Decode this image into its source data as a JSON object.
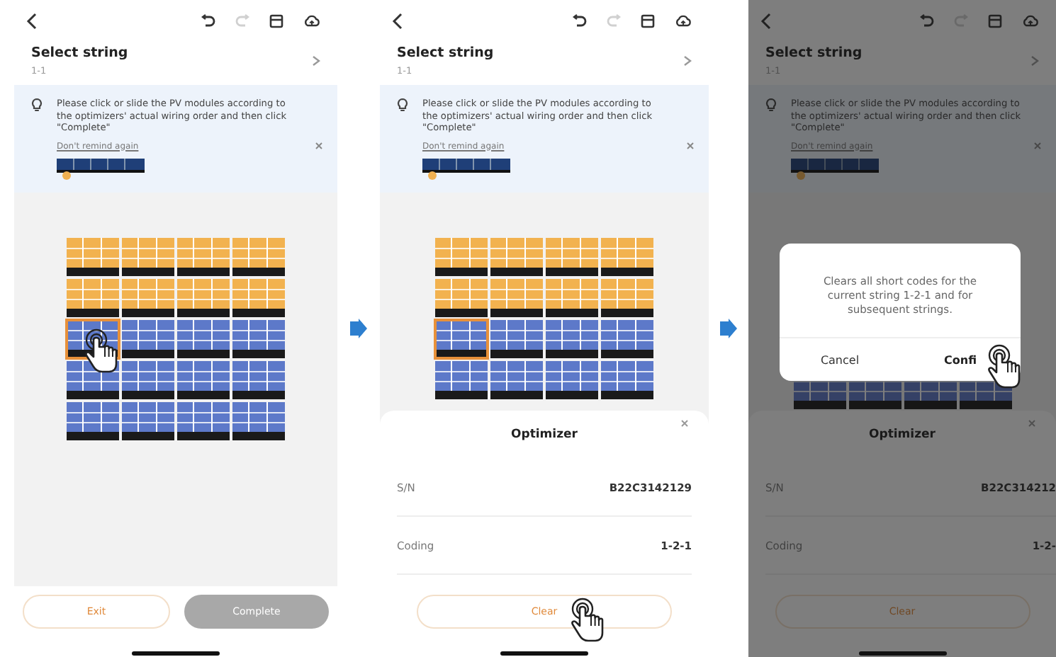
{
  "screens": [
    {
      "redo_disabled": true,
      "title": "Select string",
      "subtitle": "1-1",
      "hint": {
        "text": "Please click or slide the PV modules according to the optimizers' actual wiring order and then click \"Complete\"",
        "link": "Don't remind again"
      },
      "hand_on_selected": true,
      "grid": [
        {
          "cells": [
            {
              "coded": true,
              "selected": false
            },
            {
              "coded": true,
              "selected": false
            },
            {
              "coded": true,
              "selected": false
            },
            {
              "coded": true,
              "selected": false
            }
          ]
        },
        {
          "cells": [
            {
              "coded": true,
              "selected": false
            },
            {
              "coded": true,
              "selected": false
            },
            {
              "coded": true,
              "selected": false
            },
            {
              "coded": true,
              "selected": false
            }
          ]
        },
        {
          "cells": [
            {
              "coded": false,
              "selected": true
            },
            {
              "coded": false,
              "selected": false
            },
            {
              "coded": false,
              "selected": false
            },
            {
              "coded": false,
              "selected": false
            }
          ]
        },
        {
          "cells": [
            {
              "coded": false,
              "selected": false
            },
            {
              "coded": false,
              "selected": false
            },
            {
              "coded": false,
              "selected": false
            },
            {
              "coded": false,
              "selected": false
            }
          ]
        },
        {
          "cells": [
            {
              "coded": false,
              "selected": false
            },
            {
              "coded": false,
              "selected": false
            },
            {
              "coded": false,
              "selected": false
            },
            {
              "coded": false,
              "selected": false
            }
          ]
        }
      ],
      "buttons": [
        {
          "label": "Exit",
          "kind": "outline"
        },
        {
          "label": "Complete",
          "kind": "filled",
          "disabled": true
        }
      ]
    },
    {
      "redo_disabled": true,
      "title": "Select string",
      "subtitle": "1-1",
      "hint": {
        "text": "Please click or slide the PV modules according to the optimizers' actual wiring order and then click \"Complete\"",
        "link": "Don't remind again"
      },
      "grid": [
        {
          "cells": [
            {
              "coded": true,
              "selected": false
            },
            {
              "coded": true,
              "selected": false
            },
            {
              "coded": true,
              "selected": false
            },
            {
              "coded": true,
              "selected": false
            }
          ]
        },
        {
          "cells": [
            {
              "coded": true,
              "selected": false
            },
            {
              "coded": true,
              "selected": false
            },
            {
              "coded": true,
              "selected": false
            },
            {
              "coded": true,
              "selected": false
            }
          ]
        },
        {
          "cells": [
            {
              "coded": false,
              "selected": true
            },
            {
              "coded": false,
              "selected": false
            },
            {
              "coded": false,
              "selected": false
            },
            {
              "coded": false,
              "selected": false
            }
          ]
        },
        {
          "cells": [
            {
              "coded": false,
              "selected": false
            },
            {
              "coded": false,
              "selected": false
            },
            {
              "coded": false,
              "selected": false
            },
            {
              "coded": false,
              "selected": false
            }
          ]
        }
      ],
      "sheet": {
        "title": "Optimizer",
        "rows": [
          {
            "label": "S/N",
            "value": "B22C3142129"
          },
          {
            "label": "Coding",
            "value": "1-2-1"
          }
        ],
        "button": "Clear",
        "button_pressed": true
      }
    },
    {
      "redo_disabled": true,
      "title": "Select string",
      "subtitle": "1-1",
      "hint": {
        "text": "Please click or slide the PV modules according to the optimizers' actual wiring order and then click \"Complete\"",
        "link": "Don't remind again"
      },
      "dimmed": true,
      "grid": [
        {
          "cells": [
            {
              "coded": false,
              "selected": false
            },
            {
              "coded": false,
              "selected": false
            },
            {
              "coded": false,
              "selected": false
            },
            {
              "coded": false,
              "selected": false
            }
          ]
        }
      ],
      "sheet": {
        "title": "Optimizer",
        "rows": [
          {
            "label": "S/N",
            "value": "B22C314212"
          },
          {
            "label": "Coding",
            "value": "1-2-"
          }
        ],
        "button": "Clear"
      },
      "dialog": {
        "message": "Clears all short codes for the current string 1-2-1 and for subsequent strings.",
        "buttons": [
          "Cancel",
          "Confi"
        ],
        "confirm_pressed": true
      }
    }
  ]
}
